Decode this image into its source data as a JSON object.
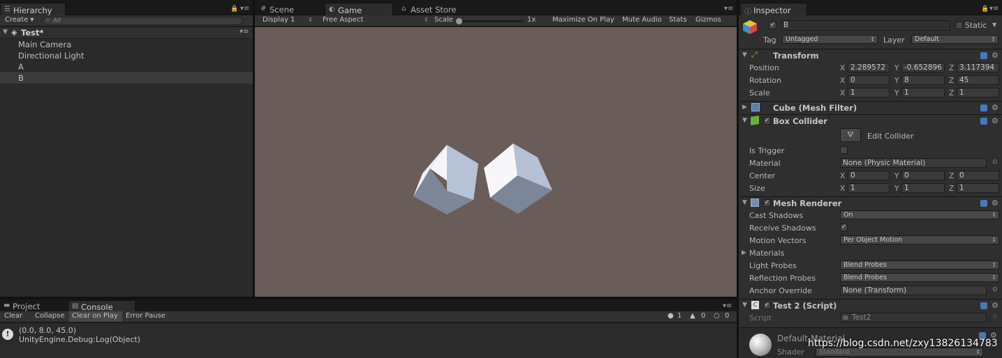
{
  "hierarchy": {
    "tab": "Hierarchy",
    "create": "Create ▾",
    "search_placeholder": "All",
    "scene": "Test*",
    "items": [
      "Main Camera",
      "Directional Light",
      "A",
      "B"
    ]
  },
  "scene_tabs": {
    "scene": "Scene",
    "game": "Game",
    "asset_store": "Asset Store"
  },
  "game_toolbar": {
    "display": "Display 1",
    "aspect": "Free Aspect",
    "scale": "Scale",
    "scale_value": "1x",
    "maximize": "Maximize On Play",
    "mute": "Mute Audio",
    "stats": "Stats",
    "gizmos": "Gizmos"
  },
  "console": {
    "tab_project": "Project",
    "tab_console": "Console",
    "clear": "Clear",
    "collapse": "Collapse",
    "clear_on_play": "Clear on Play",
    "error_pause": "Error Pause",
    "count_errors": "1",
    "count_warnings": "0",
    "count_info": "0",
    "log_line1": "(0.0, 8.0, 45.0)",
    "log_line2": "UnityEngine.Debug:Log(Object)"
  },
  "inspector": {
    "tab": "Inspector",
    "name": "B",
    "static": "Static",
    "tag_label": "Tag",
    "tag": "Untagged",
    "layer_label": "Layer",
    "layer": "Default",
    "transform": {
      "title": "Transform",
      "position": "Position",
      "rotation": "Rotation",
      "scale": "Scale",
      "px": "2.289572",
      "py": "-0.652896",
      "pz": "3.117394",
      "rx": "0",
      "ry": "8",
      "rz": "45",
      "sx": "1",
      "sy": "1",
      "sz": "1"
    },
    "mesh_filter": {
      "title": "Cube (Mesh Filter)"
    },
    "box_collider": {
      "title": "Box Collider",
      "edit": "Edit Collider",
      "is_trigger": "Is Trigger",
      "material": "Material",
      "material_value": "None (Physic Material)",
      "center": "Center",
      "cx": "0",
      "cy": "0",
      "cz": "0",
      "size": "Size",
      "sx": "1",
      "sy": "1",
      "sz": "1"
    },
    "mesh_renderer": {
      "title": "Mesh Renderer",
      "cast_shadows": "Cast Shadows",
      "cast_value": "On",
      "receive_shadows": "Receive Shadows",
      "motion_vectors": "Motion Vectors",
      "motion_value": "Per Object Motion",
      "materials": "Materials",
      "light_probes": "Light Probes",
      "light_value": "Blend Probes",
      "reflection_probes": "Reflection Probes",
      "reflection_value": "Blend Probes",
      "anchor_override": "Anchor Override",
      "anchor_value": "None (Transform)"
    },
    "script": {
      "title": "Test 2 (Script)",
      "script_label": "Script",
      "script_value": "Test2"
    },
    "material": {
      "title": "Default-Material",
      "shader_label": "Shader",
      "shader_value": "Standard"
    }
  },
  "axes": {
    "x": "X",
    "y": "Y",
    "z": "Z"
  },
  "watermark": "https://blog.csdn.net/zxy13826134783",
  "colors": {
    "game_bg": "#6a5c58",
    "panel_bg": "#2a2a2a",
    "selected_row": "#3a3a3a"
  }
}
